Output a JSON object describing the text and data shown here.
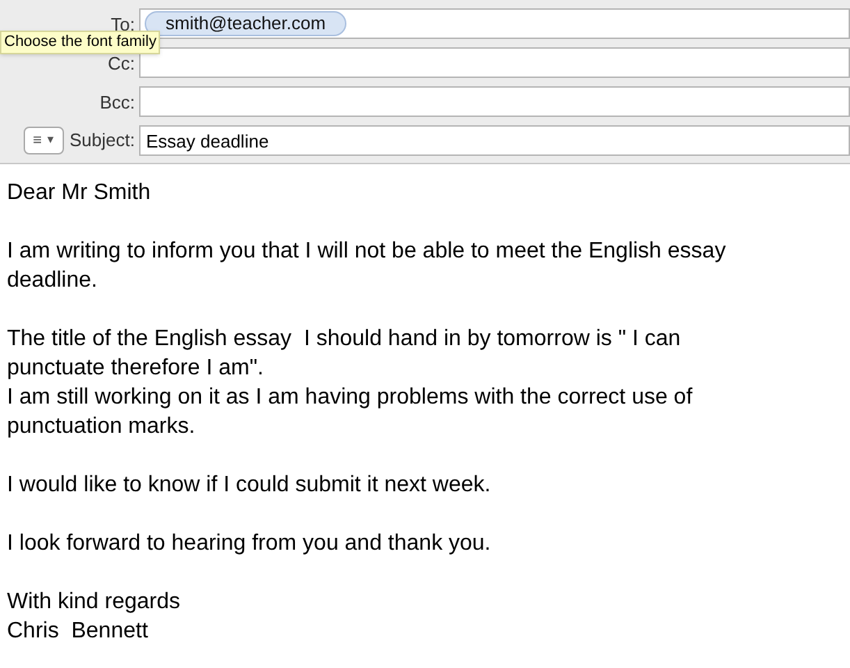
{
  "header": {
    "fields": [
      {
        "label": "To:",
        "recipients": [
          "smith@teacher.com"
        ]
      },
      {
        "label": "Cc:"
      },
      {
        "label": "Bcc:"
      }
    ],
    "format_button": {
      "icon": "≡",
      "caret": "▾"
    },
    "subject": {
      "label": "Subject:",
      "value": "Essay deadline"
    }
  },
  "tooltip": "Choose the font family",
  "body": [
    [
      "Dear Mr Smith"
    ],
    [
      "I am writing to inform you that I will not be able to meet the English essay",
      "deadline."
    ],
    [
      "The title of the English essay  I should hand in by tomorrow is \" I can",
      "punctuate therefore I am\".",
      "I am still working on it as I am having problems with the correct use of",
      "punctuation marks."
    ],
    [
      "I would like to know if I could submit it next week."
    ],
    [
      "I look forward to hearing from you and thank you."
    ],
    [
      "With kind regards",
      "Chris  Bennett"
    ]
  ]
}
